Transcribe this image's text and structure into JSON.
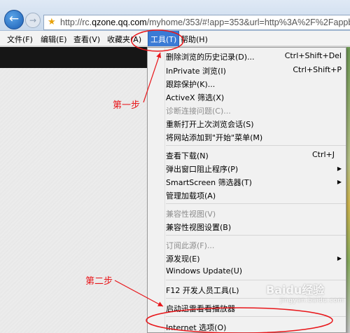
{
  "address_bar": {
    "url_prefix": "http://rc.",
    "url_domain": "qzone.qq.com",
    "url_suffix": "/myhome/353/#!app=353&url=http%3A%2F%2Fappb"
  },
  "menubar": {
    "file": "文件(F)",
    "edit": "编辑(E)",
    "view": "查看(V)",
    "favorites": "收藏夹(A)",
    "tools": "工具(T)",
    "help": "帮助(H)"
  },
  "tools_menu": {
    "items": [
      {
        "label": "删除浏览的历史记录(D)...",
        "shortcut": "Ctrl+Shift+Del"
      },
      {
        "label": "InPrivate 浏览(I)",
        "shortcut": "Ctrl+Shift+P"
      },
      {
        "label": "跟踪保护(K)...",
        "shortcut": ""
      },
      {
        "label": "ActiveX 筛选(X)",
        "shortcut": ""
      },
      {
        "label": "诊断连接问题(C)...",
        "shortcut": ""
      },
      {
        "label": "重新打开上次浏览会话(S)",
        "shortcut": ""
      },
      {
        "label": "将网站添加到\"开始\"菜单(M)",
        "shortcut": ""
      },
      {
        "label": "查看下载(N)",
        "shortcut": "Ctrl+J"
      },
      {
        "label": "弹出窗口阻止程序(P)",
        "shortcut": ""
      },
      {
        "label": "SmartScreen 筛选器(T)",
        "shortcut": ""
      },
      {
        "label": "管理加载项(A)",
        "shortcut": ""
      },
      {
        "label": "兼容性视图(V)",
        "shortcut": ""
      },
      {
        "label": "兼容性视图设置(B)",
        "shortcut": ""
      },
      {
        "label": "订阅此源(F)...",
        "shortcut": ""
      },
      {
        "label": "源发现(E)",
        "shortcut": ""
      },
      {
        "label": "Windows Update(U)",
        "shortcut": ""
      },
      {
        "label": "F12 开发人员工具(L)",
        "shortcut": ""
      },
      {
        "label": "启动迅雷看看播放器",
        "shortcut": ""
      },
      {
        "label": "Internet 选项(O)",
        "shortcut": ""
      }
    ]
  },
  "annotations": {
    "step1": "第一步",
    "step2": "第二步",
    "color": "#e8161a"
  },
  "watermark": {
    "text": "Baidu经验",
    "sub": "jingyan.baidu.com"
  }
}
